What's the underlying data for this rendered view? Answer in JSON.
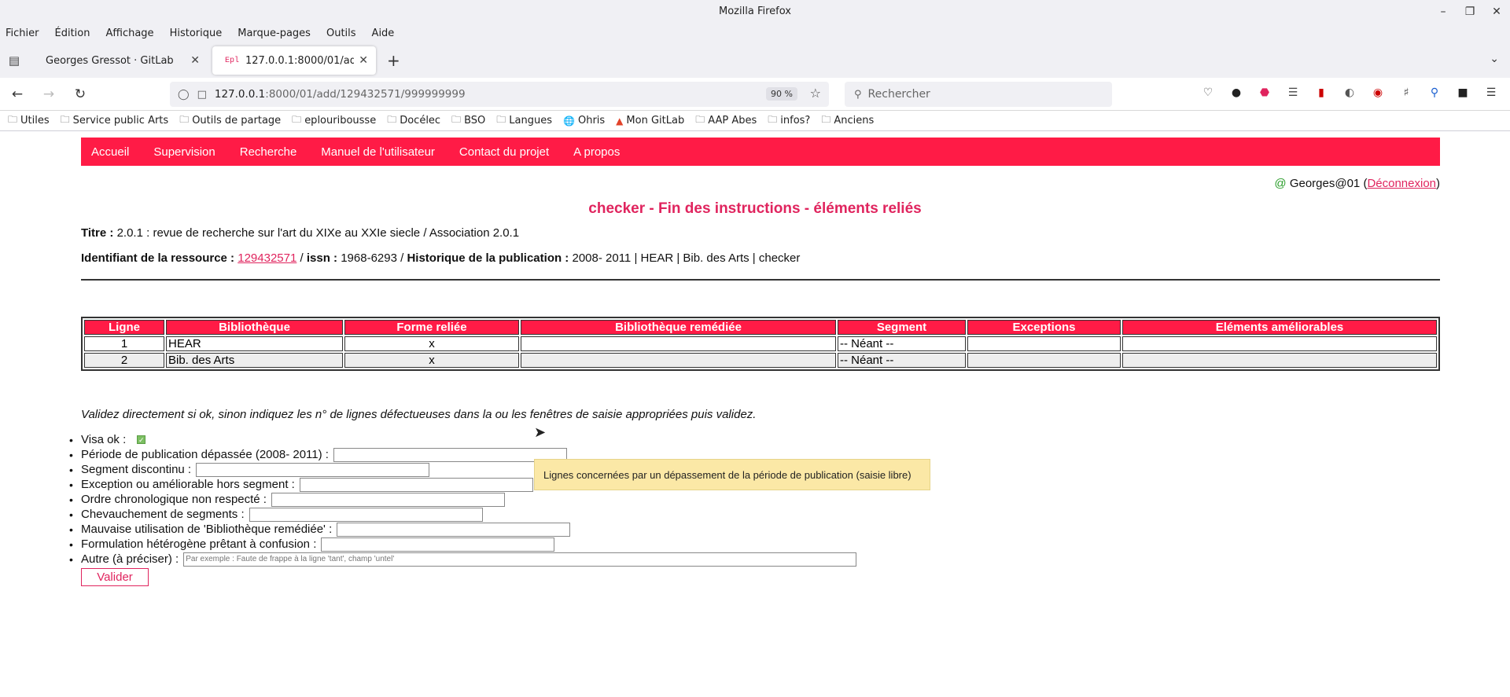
{
  "window": {
    "title": "Mozilla Firefox"
  },
  "menu": [
    "Fichier",
    "Édition",
    "Affichage",
    "Historique",
    "Marque-pages",
    "Outils",
    "Aide"
  ],
  "tabs": [
    {
      "label": "Georges Gressot · GitLab"
    },
    {
      "label": "127.0.0.1:8000/01/add/129432571/999999999",
      "favicon": "Epl"
    }
  ],
  "nav": {
    "url_host": "127.0.0.1",
    "url_rest": ":8000/01/add/129432571/999999999",
    "zoom": "90 %",
    "search_placeholder": "Rechercher"
  },
  "bookmarks": [
    "Utiles",
    "Service public Arts",
    "Outils de partage",
    "eplouribousse",
    "Docélec",
    "BSO",
    "Langues",
    "Ohris",
    "Mon GitLab",
    "AAP Abes",
    "infos?",
    "Anciens"
  ],
  "site_nav": [
    "Accueil",
    "Supervision",
    "Recherche",
    "Manuel de l'utilisateur",
    "Contact du projet",
    "A propos"
  ],
  "user": {
    "at": "@",
    "name": "Georges@01",
    "open": "(",
    "logout": "Déconnexion",
    "close": ")"
  },
  "page_title": "checker - Fin des instructions - éléments reliés",
  "meta": {
    "titre_label": "Titre :",
    "titre_value": "2.0.1 : revue de recherche sur l'art du XIXe au XXIe siecle / Association 2.0.1",
    "id_label": "Identifiant de la ressource :",
    "id_value": "129432571",
    "sep1": "/",
    "issn_label": "issn :",
    "issn_value": "1968-6293",
    "sep2": "/",
    "hist_label": "Historique de la publication :",
    "hist_value": "2008- 2011 | HEAR | Bib. des Arts | checker"
  },
  "table": {
    "headers": [
      "Ligne",
      "Bibliothèque",
      "Forme reliée",
      "Bibliothèque remédiée",
      "Segment",
      "Exceptions",
      "Eléments améliorables"
    ],
    "rows": [
      [
        "1",
        "HEAR",
        "x",
        "",
        "-- Néant --",
        "",
        ""
      ],
      [
        "2",
        "Bib. des Arts",
        "x",
        "",
        "-- Néant --",
        "",
        ""
      ]
    ]
  },
  "instructions": "Validez directement si ok, sinon indiquez les n° de lignes défectueuses dans la ou les fenêtres de saisie appropriées puis validez.",
  "form": {
    "visa_label": "Visa ok :",
    "visa_checked": true,
    "fields": [
      {
        "label": "Période de publication dépassée (2008- 2011) :",
        "value": ""
      },
      {
        "label": "Segment discontinu :",
        "value": ""
      },
      {
        "label": "Exception ou améliorable hors segment :",
        "value": ""
      },
      {
        "label": "Ordre chronologique non respecté :",
        "value": ""
      },
      {
        "label": "Chevauchement de segments :",
        "value": ""
      },
      {
        "label": "Mauvaise utilisation de 'Bibliothèque remédiée' :",
        "value": ""
      },
      {
        "label": "Formulation hétérogène prêtant à confusion :",
        "value": ""
      }
    ],
    "autre_label": "Autre (à préciser) :",
    "autre_placeholder": "Par exemple : Faute de frappe à la ligne 'tant', champ 'untel'",
    "submit_label": "Valider"
  },
  "tooltip": "Lignes concernées par un dépassement de la période de publication (saisie libre)",
  "colors": {
    "accent": "#ff1b46",
    "link": "#e0245e",
    "tooltip_bg": "#fbe8a6"
  }
}
